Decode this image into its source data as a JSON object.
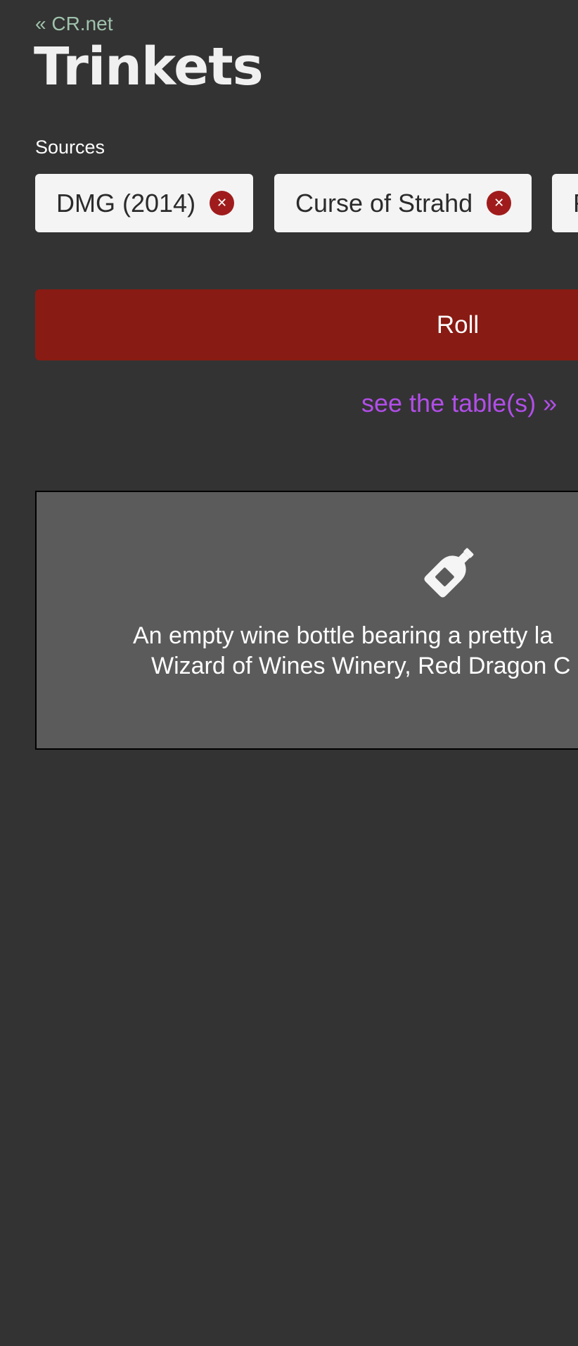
{
  "nav": {
    "back_link": "« CR.net"
  },
  "page": {
    "title": "Trinkets"
  },
  "sources": {
    "label": "Sources",
    "chips": [
      {
        "label": "DMG (2014)",
        "remove_icon": "close-icon"
      },
      {
        "label": "Curse of Strahd",
        "remove_icon": "close-icon"
      },
      {
        "label": "F",
        "remove_icon": "close-icon"
      }
    ]
  },
  "actions": {
    "roll_label": "Roll",
    "table_link": "see the table(s) »"
  },
  "result": {
    "icon": "wine-bottle-icon",
    "line_1": "An empty wine bottle bearing a pretty la",
    "line_2": "Wizard of Wines Winery, Red Dragon C"
  },
  "colors": {
    "background": "#333333",
    "back_link": "#9fc2ac",
    "chip_background": "#f4f4f4",
    "chip_remove": "#a01c1c",
    "roll_button": "#881b13",
    "table_link": "#b14ee8",
    "result_card": "#5b5b5b"
  }
}
